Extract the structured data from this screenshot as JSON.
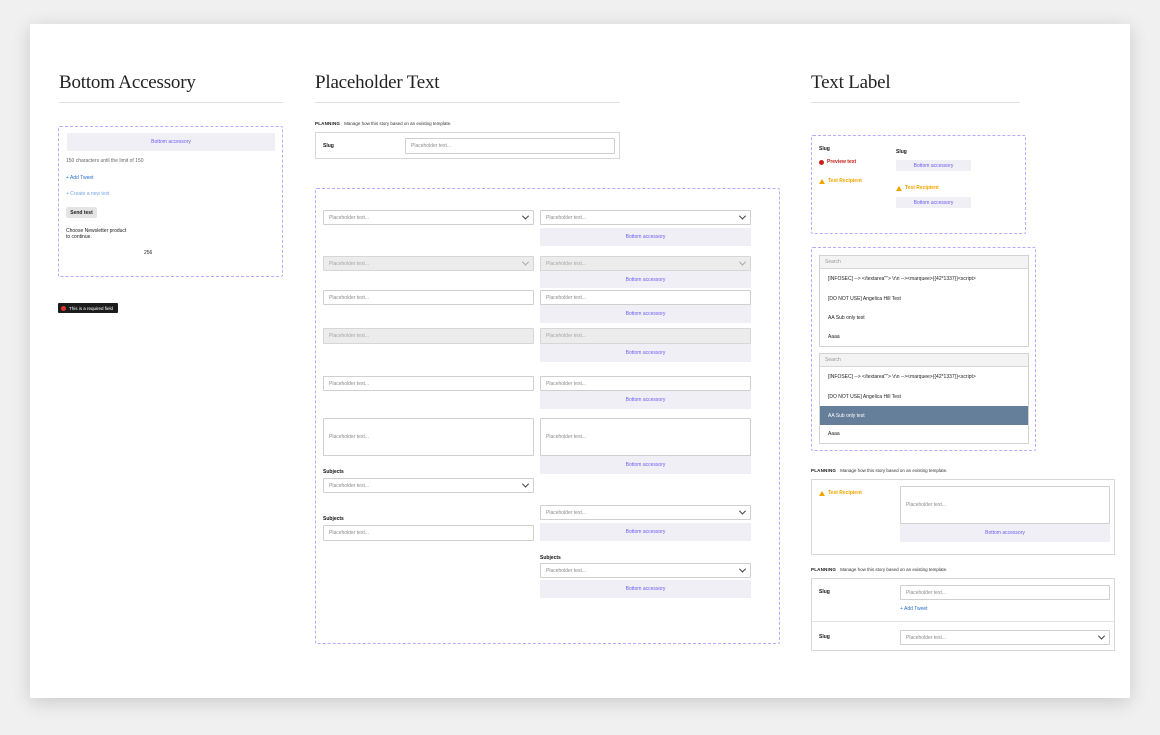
{
  "sections": {
    "bottom_accessory": "Bottom Accessory",
    "placeholder_text": "Placeholder Text",
    "text_label": "Text Label"
  },
  "common": {
    "placeholder": "Placeholder text...",
    "bottom_accessory": "Bottom accessory",
    "planning_label": "PLANNING",
    "planning_desc": "Manage how this story based on an existing template.",
    "slug": "Slug",
    "subjects": "Subjects",
    "add_tweet": "+ Add Tweet",
    "test_recipient": "Test Recipient",
    "preview_text": "Preview text",
    "search": "Search"
  },
  "left": {
    "char_count": "150 characters until the limit of 150",
    "add_tweet": "+ Add Tweet",
    "create_new": "+ Create a new text",
    "send_test": "Send test",
    "choose_line1": "Choose Newsletter product",
    "choose_line2": "to continue.",
    "number": "256",
    "tooltip": "This is a required field"
  },
  "list_items": [
    "[INFOSEC] --> </textarea\"\"> \\r\\n --><marquee>{{42*1337}}<script>",
    "[DO NOT USE] Angelica Hill Test",
    "AA Sub only test",
    "Aaaa"
  ],
  "colors": {
    "accent": "#6b5cf5",
    "dashed_border": "#b9a9ff",
    "warning": "#f0a500",
    "error": "#c4231b",
    "selected_row": "#657f9b",
    "link": "#2a6fd0"
  }
}
